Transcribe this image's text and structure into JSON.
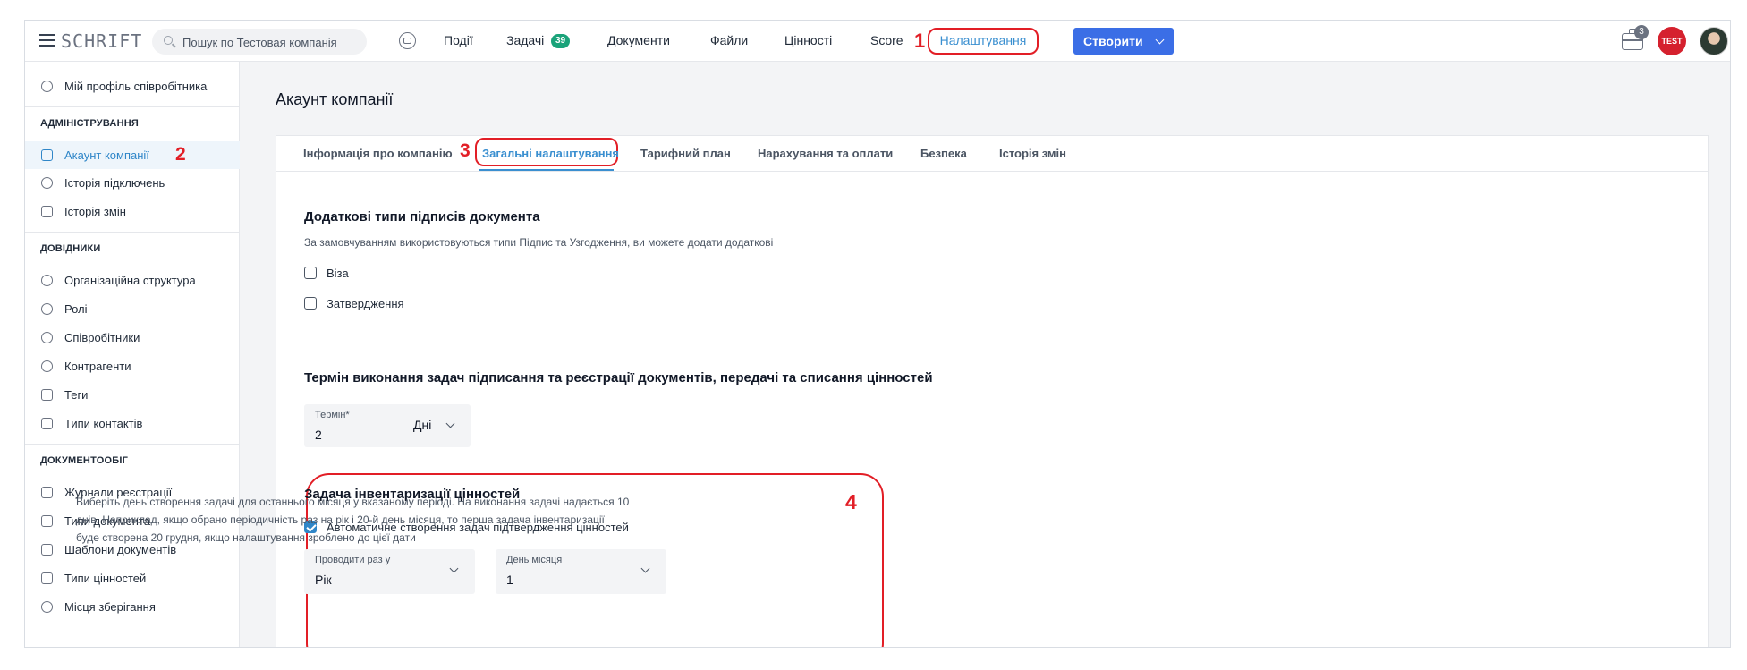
{
  "header": {
    "logo": "SCHRIFT",
    "search_placeholder": "Пошук по Тестовая компанія",
    "nav": [
      "Події",
      "Задачі",
      "Документи",
      "Файли",
      "Цінності",
      "Score"
    ],
    "tasks_badge": "39",
    "settings": "Налаштування",
    "create_button": "Створити",
    "notifications_count": "3",
    "company_logo_text": "TEST",
    "marks": [
      "1",
      "2",
      "3",
      "4"
    ]
  },
  "sidebar": {
    "profile": "Мій профіль співробітника",
    "sections": [
      {
        "title": "АДМІНІСТРУВАННЯ",
        "items": [
          "Акаунт компанії",
          "Історія підключень",
          "Історія змін"
        ]
      },
      {
        "title": "ДОВІДНИКИ",
        "items": [
          "Організаційна структура",
          "Ролі",
          "Співробітники",
          "Контрагенти",
          "Теги",
          "Типи контактів"
        ]
      },
      {
        "title": "ДОКУМЕНТООБІГ",
        "items": [
          "Журнали реєстрації",
          "Типи документа",
          "Шаблони документів",
          "Типи цінностей",
          "Місця зберігання"
        ]
      }
    ]
  },
  "main": {
    "title": "Акаунт компанії",
    "tabs": [
      "Інформація про компанію",
      "Загальні налаштування",
      "Тарифний план",
      "Нарахування та оплати",
      "Безпека",
      "Історія змін"
    ],
    "signatures": {
      "title": "Додаткові типи підписів документа",
      "note": "За замовчуванням використовуються типи Підпис та Узгодження, ви можете додати додаткові",
      "options": [
        "Віза",
        "Затвердження"
      ]
    },
    "deadline": {
      "title": "Термін виконання задач підписання та реєстрації документів, передачі та списання цінностей",
      "field_label": "Термін*",
      "field_value": "2",
      "unit": "Дні"
    },
    "inventory": {
      "title": "Задача інвентаризації цінностей",
      "auto_create": "Автоматичне створення задач підтвердження цінностей",
      "period_label": "Проводити раз у",
      "period_value": "Рік",
      "day_label": "День місяця",
      "day_value": "1",
      "hint": "Виберіть день створення задачі для останнього місяця у вказаному періоді. На виконання задачі надається 10 днів. Наприклад, якщо обрано періодичність раз на рік і 20-й день місяця, то перша задача інвентаризації буде створена 20 грудня, якщо налаштування зроблено до цієї дати"
    }
  }
}
